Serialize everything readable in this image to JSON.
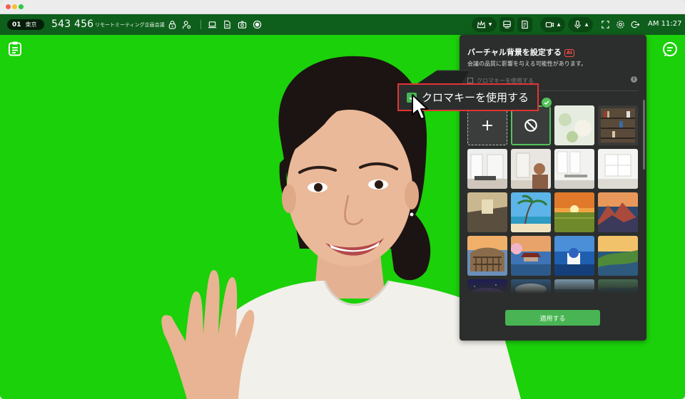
{
  "window": {
    "controls": [
      "close",
      "minimize",
      "maximize"
    ]
  },
  "toolbar": {
    "room_number": "01",
    "room_city": "東京",
    "meeting_id": "543 456",
    "meeting_title": "リモートミーティング企画会議",
    "clock": "AM 11:27",
    "left_icons": [
      "lock-icon",
      "user-settings-icon",
      "laptop-icon",
      "document-icon",
      "camera-icon",
      "record-icon"
    ],
    "right_icons": [
      "crown-icon",
      "layout-icon",
      "notes-icon",
      "video-icon",
      "microphone-icon",
      "fullscreen-icon",
      "gear-icon",
      "exit-icon"
    ]
  },
  "scene": {
    "left_icon": "clipboard-icon",
    "right_icon": "chat-icon",
    "background_color": "#1bd10a"
  },
  "panel": {
    "title": "バーチャル背景を設定する",
    "ai_badge": "AI",
    "subtitle": "会議の品質に影響を与える可能性があります。",
    "chroma_label": "クロマキーを使用する",
    "apply_label": "適用する",
    "thumbnails": [
      {
        "type": "add",
        "icon": "plus-icon",
        "glyph": "+"
      },
      {
        "type": "none",
        "icon": "no-background-icon",
        "selected": true
      },
      {
        "type": "image",
        "name": "blur-bokeh"
      },
      {
        "type": "image",
        "name": "bookshelf"
      },
      {
        "type": "image",
        "name": "white-room"
      },
      {
        "type": "image",
        "name": "office-desk"
      },
      {
        "type": "image",
        "name": "dining-room"
      },
      {
        "type": "image",
        "name": "white-interior"
      },
      {
        "type": "image",
        "name": "lobby"
      },
      {
        "type": "image",
        "name": "tropical-beach"
      },
      {
        "type": "image",
        "name": "field-sunset"
      },
      {
        "type": "image",
        "name": "mountains-sunset"
      },
      {
        "type": "image",
        "name": "colosseum"
      },
      {
        "type": "image",
        "name": "pagoda-lake"
      },
      {
        "type": "image",
        "name": "santorini"
      },
      {
        "type": "image",
        "name": "coast-sunset"
      },
      {
        "type": "image",
        "name": "galaxy"
      },
      {
        "type": "image",
        "name": "cloud-sky"
      },
      {
        "type": "image",
        "name": "ocean-blue"
      },
      {
        "type": "image",
        "name": "aerial-coast"
      }
    ],
    "accent_color": "#48b453"
  },
  "callout": {
    "label": "クロマキーを使用する",
    "checked": true,
    "highlight_color": "#e23434"
  }
}
